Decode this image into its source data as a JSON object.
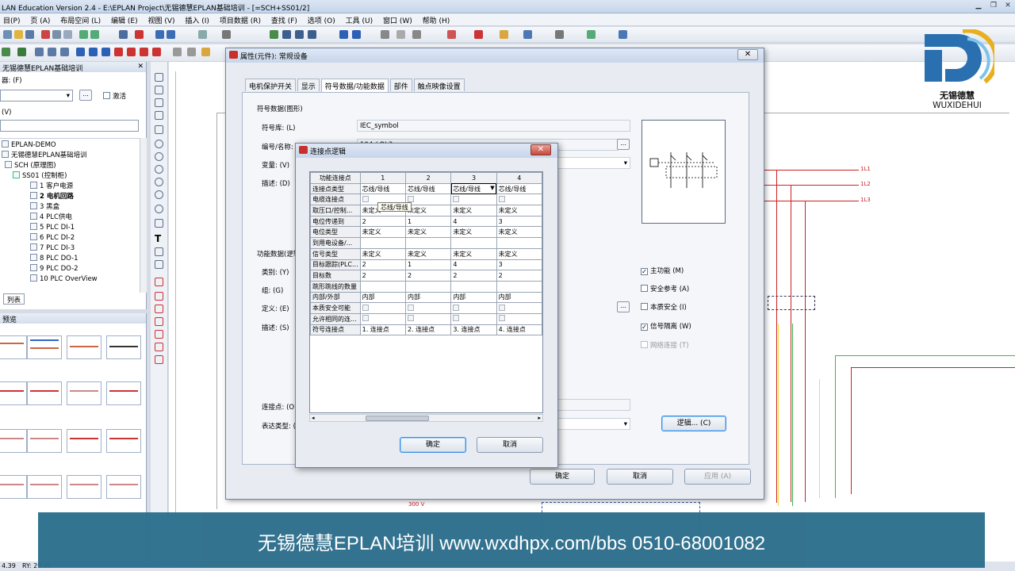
{
  "app": {
    "title": "LAN Education Version 2.4 - E:\\EPLAN Project\\无锡德慧EPLAN基础培训 - [=SCH+SS01/2]"
  },
  "menu": [
    "目(P)",
    "页 (A)",
    "布局空间 (L)",
    "编辑 (E)",
    "视图 (V)",
    "插入 (I)",
    "项目数据 (R)",
    "查找 (F)",
    "选项 (O)",
    "工具 (U)",
    "窗口 (W)",
    "帮助 (H)"
  ],
  "leftpanel": {
    "title": "无锡德慧EPLAN基础培训",
    "filter_label": "器: (F)",
    "filter_btn": "...",
    "activate_label": "激活",
    "v_label": "(V)",
    "tree": [
      "EPLAN-DEMO",
      "无锡德慧EPLAN基础培训",
      "SCH (原理图)",
      "SS01 (控制柜)",
      "1 客户电源",
      "2 电机回路",
      "3 黑盒",
      "4 PLC供电",
      "5 PLC DI-1",
      "6 PLC DI-2",
      "7 PLC DI-3",
      "8 PLC DO-1",
      "9 PLC DO-2",
      "10 PLC OverView"
    ],
    "tab_list": "列表"
  },
  "graphic_panel": {
    "title": "预览"
  },
  "prop_dialog": {
    "title": "属性(元件): 常规设备",
    "close": "✕",
    "tabs": [
      "电机保护开关",
      "显示",
      "符号数据/功能数据",
      "部件",
      "触点映像设置"
    ],
    "symbol_section": "符号数据(图形)",
    "symbol_lib_label": "符号库: (L)",
    "symbol_lib_value": "IEC_symbol",
    "number_label": "编号/名称: (N)",
    "number_value": "104 / QL3",
    "variant_label": "变量: (V)",
    "desc_label": "描述: (D)",
    "func_section": "功能数据(逻辑)",
    "category_label": "类别: (Y)",
    "group_label": "组: (G)",
    "define_label": "定义: (E)",
    "func_desc_label": "描述: (S)",
    "conn_label": "连接点: (O)",
    "repr_label": "表达类型: (R)",
    "checks": [
      {
        "label": "主功能 (M)",
        "checked": true,
        "disabled": false
      },
      {
        "label": "安全参考 (A)",
        "checked": false,
        "disabled": false
      },
      {
        "label": "本质安全 (I)",
        "checked": false,
        "disabled": false
      },
      {
        "label": "信号隔离 (W)",
        "checked": true,
        "disabled": false
      },
      {
        "label": "网络连接 (T)",
        "checked": false,
        "disabled": true
      }
    ],
    "logic_btn": "逻辑... (C)",
    "ok": "确定",
    "cancel": "取消",
    "apply": "应用 (A)"
  },
  "logic_dialog": {
    "title": "连接点逻辑",
    "close": "✕",
    "header_first": "功能连接点",
    "columns": [
      "1",
      "2",
      "3",
      "4"
    ],
    "rows": [
      {
        "label": "连接点类型",
        "cells": [
          "芯线/导线",
          "芯线/导线",
          "芯线/导线",
          "芯线/导线"
        ]
      },
      {
        "label": "电缆连接点",
        "cells": [
          "[ ]",
          "[ ]",
          "[ ]",
          "[ ]"
        ]
      },
      {
        "label": "取压口/控制...",
        "cells": [
          "未定义",
          "未定义",
          "未定义",
          "未定义"
        ]
      },
      {
        "label": "电位传递到",
        "cells": [
          "2",
          "1",
          "4",
          "3"
        ]
      },
      {
        "label": "电位类型",
        "cells": [
          "未定义",
          "未定义",
          "未定义",
          "未定义"
        ]
      },
      {
        "label": "到用电设备/...",
        "cells": [
          "",
          "",
          "",
          ""
        ]
      },
      {
        "label": "信号类型",
        "cells": [
          "未定义",
          "未定义",
          "未定义",
          "未定义"
        ]
      },
      {
        "label": "目标跟踪(PLC...",
        "cells": [
          "2",
          "1",
          "4",
          "3"
        ]
      },
      {
        "label": "目标数",
        "cells": [
          "2",
          "2",
          "2",
          "2"
        ]
      },
      {
        "label": "跳形跳线的数量",
        "cells": [
          "",
          "",
          "",
          ""
        ]
      },
      {
        "label": "内部/外部",
        "cells": [
          "内部",
          "内部",
          "内部",
          "内部"
        ]
      },
      {
        "label": "本质安全可能",
        "cells": [
          "[ ]",
          "[ ]",
          "[ ]",
          "[ ]"
        ]
      },
      {
        "label": "允许相同的连...",
        "cells": [
          "[ ]",
          "[ ]",
          "[ ]",
          "[ ]"
        ]
      },
      {
        "label": "符号连接点",
        "cells": [
          "1. 连接点",
          "2. 连接点",
          "3. 连接点",
          "4. 连接点"
        ]
      }
    ],
    "tooltip": "芯线/导线",
    "ok": "确定",
    "cancel": "取消"
  },
  "logo": {
    "cn": "无锡德慧",
    "en": "WUXIDEHUI"
  },
  "banner": {
    "text": "无锡德慧EPLAN培训 www.wxdhpx.com/bbs  0510-68001082"
  },
  "drawing": {
    "labels": [
      "1L1",
      "1L2",
      "1L3",
      "300 V"
    ]
  },
  "statusbar": {
    "left": "4.39",
    "ry": "RY: 29.21"
  },
  "colors": {
    "banner": "#2b6e8c",
    "accent": "#c8312b",
    "wire_red": "#d02020",
    "wire_green": "#3cb84a",
    "wire_yellow": "#e8e23c"
  }
}
